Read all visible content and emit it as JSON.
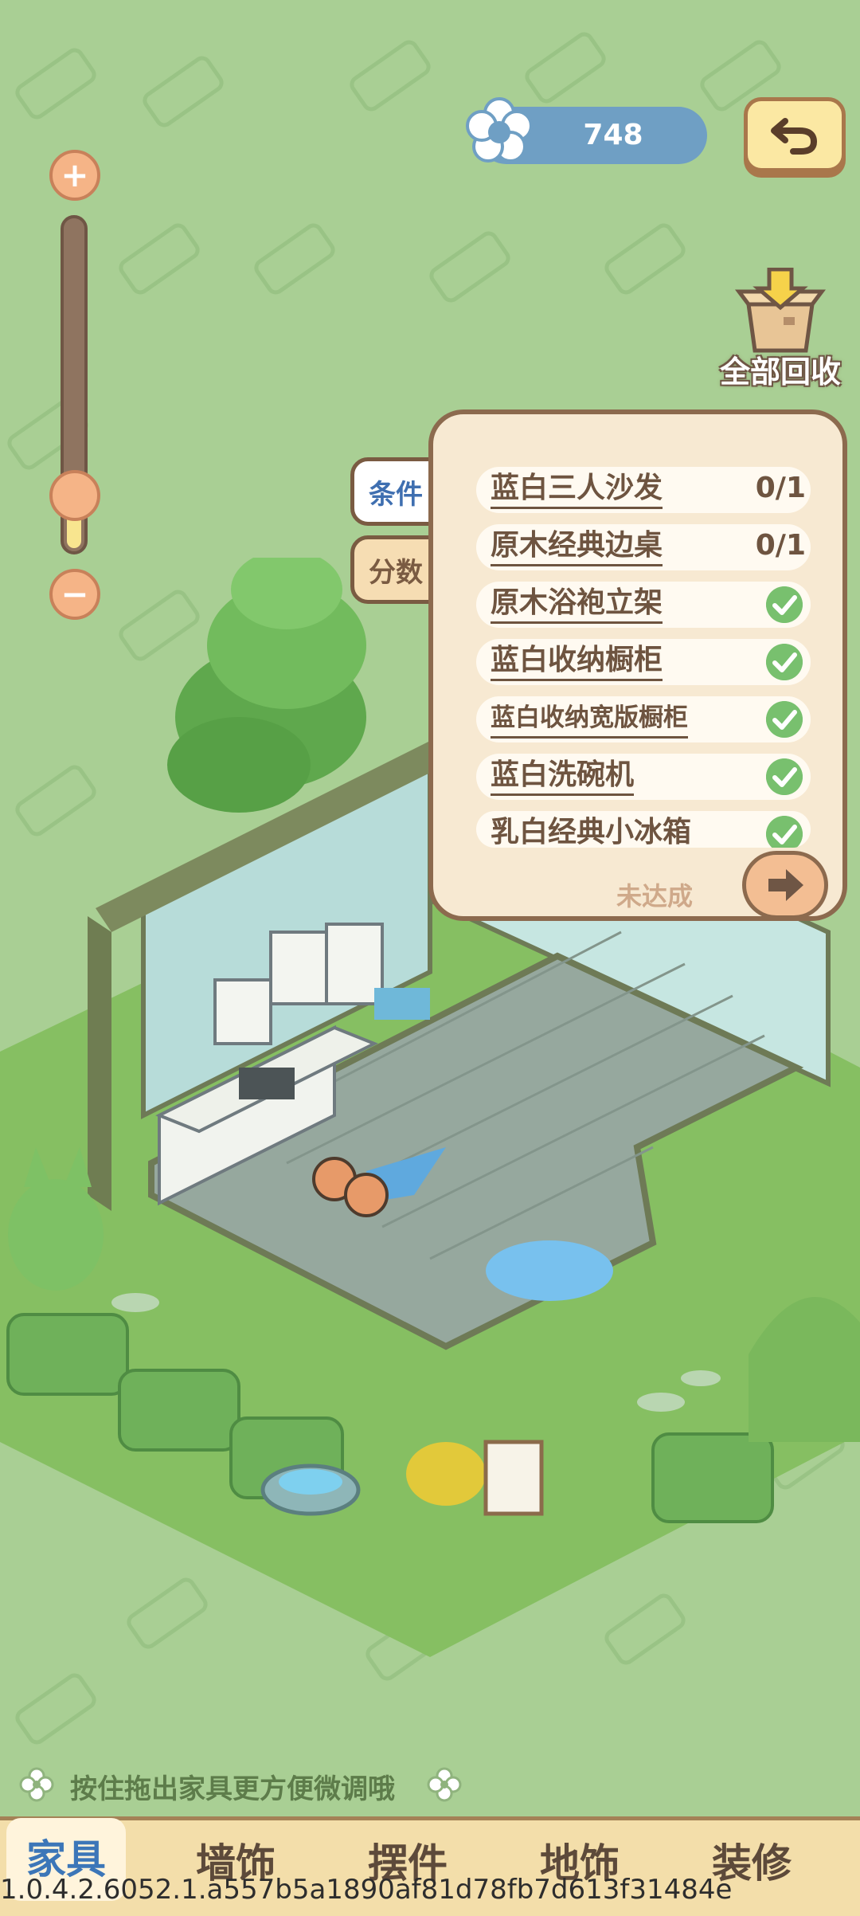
{
  "currency": {
    "value": "748",
    "icon": "flower-icon"
  },
  "zoom": {
    "plus_icon": "plus-icon",
    "minus_icon": "minus-icon",
    "level": 0.2
  },
  "recycle_all": {
    "label": "全部回收",
    "icon": "box-recycle-icon"
  },
  "side_tabs": {
    "conditions": "条件",
    "score": "分数"
  },
  "conditions": {
    "items": [
      {
        "label": "蓝白三人沙发",
        "count": "0/1",
        "done": false
      },
      {
        "label": "原木经典边桌",
        "count": "0/1",
        "done": false
      },
      {
        "label": "原木浴袍立架",
        "done": true
      },
      {
        "label": "蓝白收纳橱柜",
        "done": true
      },
      {
        "label": "蓝白收纳宽版橱柜",
        "done": true
      },
      {
        "label": "蓝白洗碗机",
        "done": true
      },
      {
        "label": "乳白经典小冰箱",
        "done": true
      }
    ],
    "status": "未达成"
  },
  "hint": {
    "text": "按住拖出家具更方便微调哦"
  },
  "bottom_tabs": [
    "家具",
    "墙饰",
    "摆件",
    "地饰",
    "装修"
  ],
  "build_version": "1.0.4.2.6052.1.a557b5a1890af81d78fb7d613f31484e",
  "colors": {
    "background": "#a9cf94",
    "accent_blue": "#3f6fb0",
    "panel": "#f7e9d2"
  }
}
